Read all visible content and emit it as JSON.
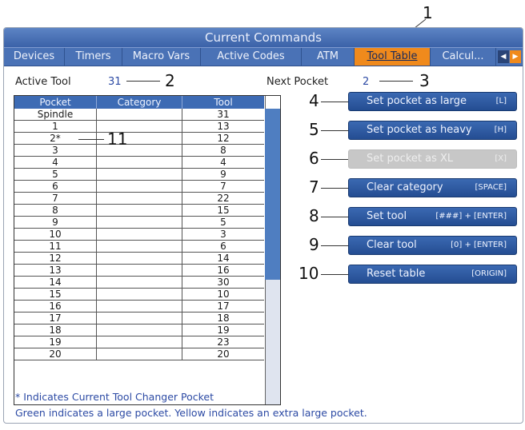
{
  "window": {
    "title": "Current Commands"
  },
  "tabs": [
    {
      "label": "Devices"
    },
    {
      "label": "Timers"
    },
    {
      "label": "Macro Vars"
    },
    {
      "label": "Active Codes"
    },
    {
      "label": "ATM"
    },
    {
      "label": "Tool Table",
      "active": true
    },
    {
      "label": "Calcul..."
    }
  ],
  "tab_arrows": {
    "left": "◀",
    "right": "▶"
  },
  "active_tool": {
    "label": "Active Tool",
    "value": "31"
  },
  "next_pocket": {
    "label": "Next Pocket",
    "value": "2"
  },
  "table": {
    "headers": [
      "Pocket",
      "Category",
      "Tool"
    ],
    "rows": [
      {
        "pocket": "Spindle",
        "category": "",
        "tool": "31"
      },
      {
        "pocket": "1",
        "category": "",
        "tool": "13"
      },
      {
        "pocket": "2*",
        "category": "",
        "tool": "12"
      },
      {
        "pocket": "3",
        "category": "",
        "tool": "8"
      },
      {
        "pocket": "4",
        "category": "",
        "tool": "4"
      },
      {
        "pocket": "5",
        "category": "",
        "tool": "9"
      },
      {
        "pocket": "6",
        "category": "",
        "tool": "7"
      },
      {
        "pocket": "7",
        "category": "",
        "tool": "22"
      },
      {
        "pocket": "8",
        "category": "",
        "tool": "15"
      },
      {
        "pocket": "9",
        "category": "",
        "tool": "5"
      },
      {
        "pocket": "10",
        "category": "",
        "tool": "3"
      },
      {
        "pocket": "11",
        "category": "",
        "tool": "6"
      },
      {
        "pocket": "12",
        "category": "",
        "tool": "14"
      },
      {
        "pocket": "13",
        "category": "",
        "tool": "16"
      },
      {
        "pocket": "14",
        "category": "",
        "tool": "30"
      },
      {
        "pocket": "15",
        "category": "",
        "tool": "10"
      },
      {
        "pocket": "16",
        "category": "",
        "tool": "17"
      },
      {
        "pocket": "17",
        "category": "",
        "tool": "18"
      },
      {
        "pocket": "18",
        "category": "",
        "tool": "19"
      },
      {
        "pocket": "19",
        "category": "",
        "tool": "23"
      },
      {
        "pocket": "20",
        "category": "",
        "tool": "20"
      }
    ]
  },
  "buttons": [
    {
      "label": "Set pocket as large",
      "key": "[L]",
      "enabled": true
    },
    {
      "label": "Set pocket as heavy",
      "key": "[H]",
      "enabled": true
    },
    {
      "label": "Set pocket as XL",
      "key": "[X]",
      "enabled": false
    },
    {
      "label": "Clear category",
      "key": "[SPACE]",
      "enabled": true
    },
    {
      "label": "Set tool",
      "key": "[###] + [ENTER]",
      "enabled": true
    },
    {
      "label": "Clear tool",
      "key": "[0] + [ENTER]",
      "enabled": true
    },
    {
      "label": "Reset table",
      "key": "[ORIGIN]",
      "enabled": true
    }
  ],
  "footer": {
    "line1": "* Indicates Current Tool Changer Pocket",
    "line2": "Green indicates a large pocket. Yellow indicates an extra large pocket."
  },
  "callouts": [
    "1",
    "2",
    "3",
    "4",
    "5",
    "6",
    "7",
    "8",
    "9",
    "10",
    "11"
  ],
  "colors": {
    "accent": "#f08a1c",
    "header": "#3d6bb4",
    "button": "#244d92",
    "value_text": "#2c4aa4"
  }
}
